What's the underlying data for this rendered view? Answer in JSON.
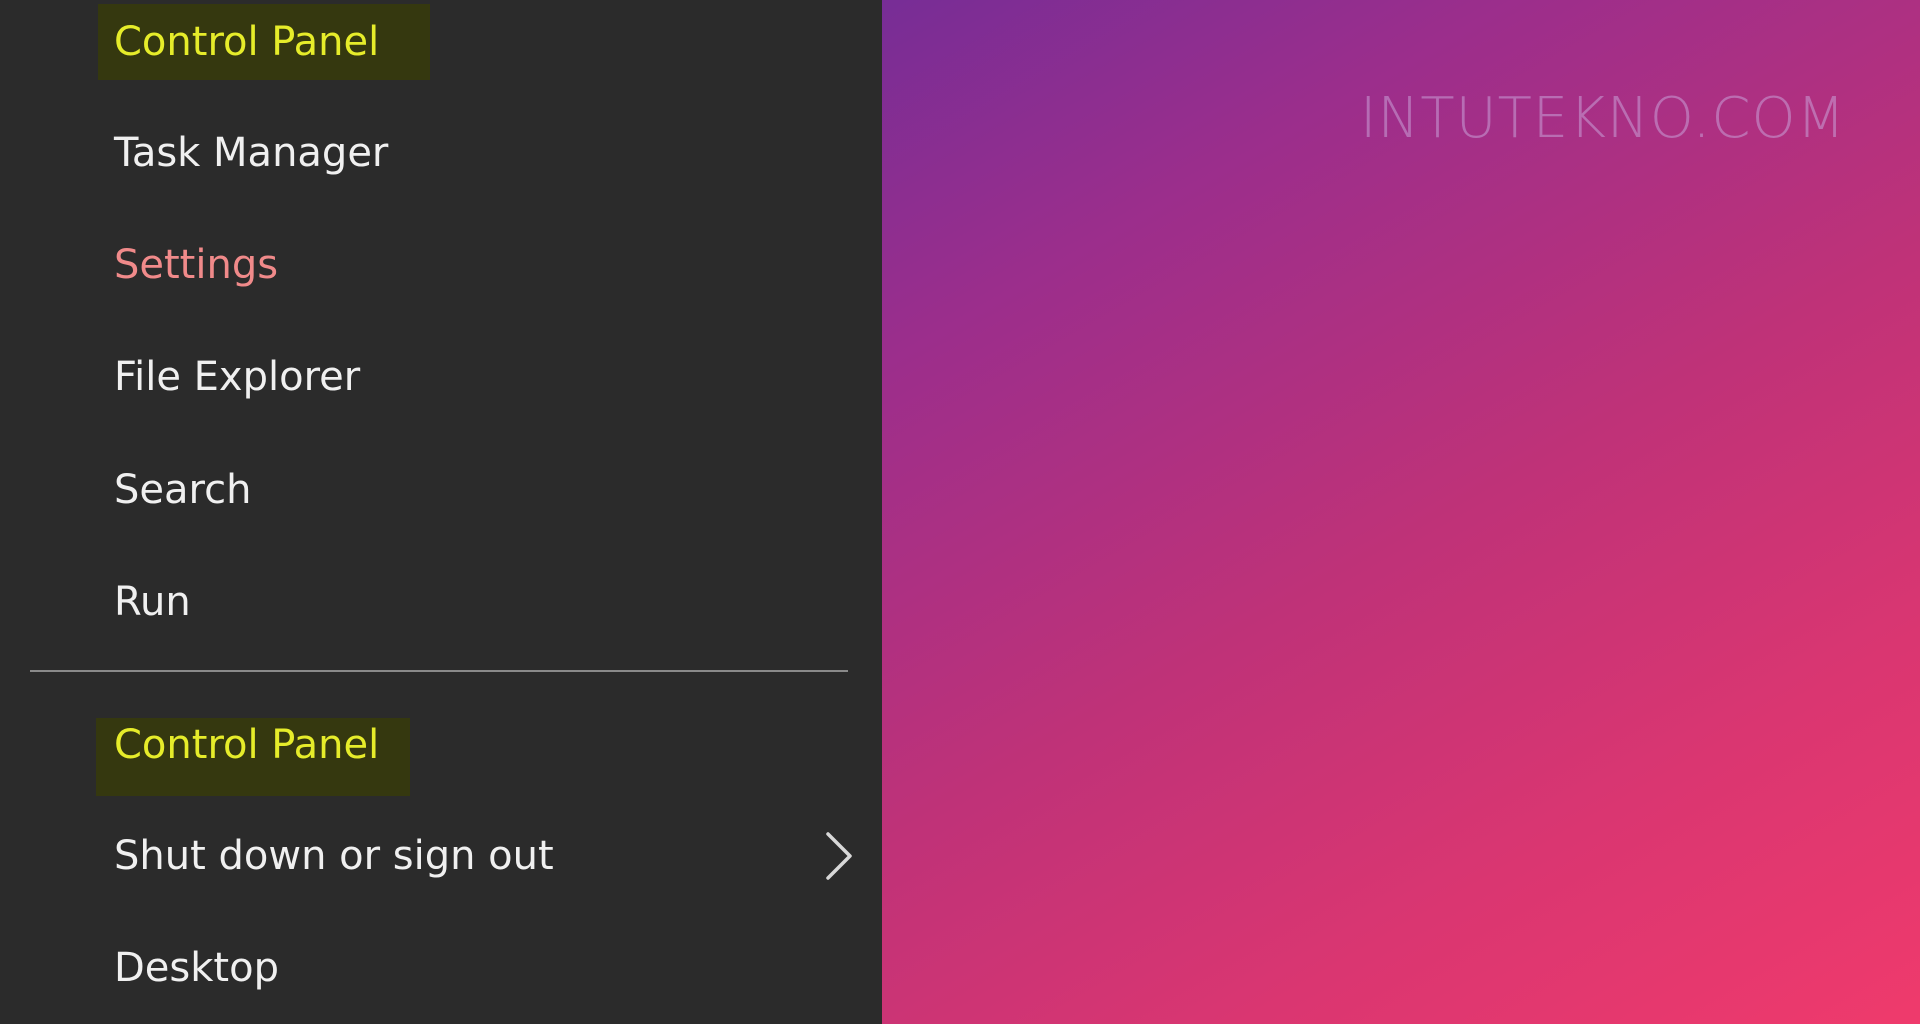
{
  "menu": {
    "items": [
      {
        "label": "Control Panel"
      },
      {
        "label": "Task Manager"
      },
      {
        "label": "Settings"
      },
      {
        "label": "File Explorer"
      },
      {
        "label": "Search"
      },
      {
        "label": "Run"
      },
      {
        "label": "Control Panel"
      },
      {
        "label": "Shut down or sign out"
      },
      {
        "label": "Desktop"
      }
    ]
  },
  "watermark": {
    "text": "INTUTEKNO.COM"
  },
  "colors": {
    "menu_bg": "#2b2b2b",
    "highlight_text": "#e6ec2a",
    "settings_text": "#f08a8a",
    "separator": "#8a8a8a"
  },
  "icons": {
    "submenu_arrow": "chevron-right-icon"
  }
}
